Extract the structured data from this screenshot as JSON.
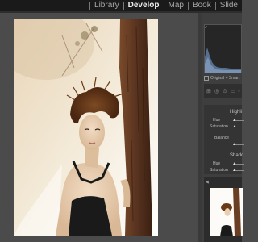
{
  "modules": [
    {
      "label": "Library",
      "active": false
    },
    {
      "label": "Develop",
      "active": true
    },
    {
      "label": "Map",
      "active": false
    },
    {
      "label": "Book",
      "active": false
    },
    {
      "label": "Slide",
      "active": false
    }
  ],
  "histogram": {
    "info": "Original + Smart"
  },
  "split_toning": {
    "highlights_label": "Highli",
    "shadows_label": "Shado",
    "hue_label": "Hue",
    "saturation_label": "Saturation",
    "balance_label": "Balance"
  },
  "colors": {
    "top_bar": "#1a1a1a",
    "active_module": "#eeeeee",
    "inactive_module": "#a8a8a8",
    "workspace": "#4b4b4b",
    "panel": "#3e3e3e",
    "histogram_fill": "#5f7ea6"
  },
  "icons": [
    "crop-icon",
    "spot-removal-icon",
    "red-eye-icon",
    "graduated-filter-icon",
    "adjustment-brush-icon",
    "collapse-triangle-icon"
  ]
}
